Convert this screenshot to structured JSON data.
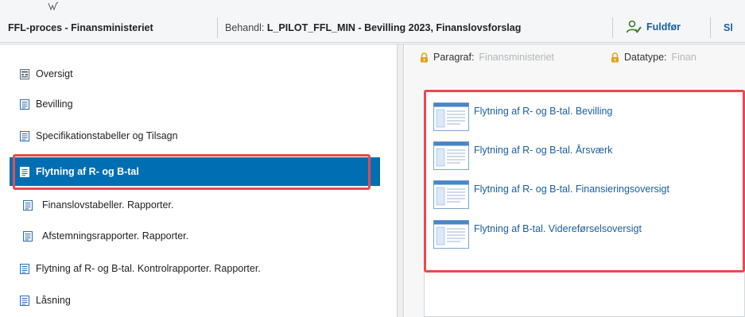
{
  "header": {
    "title": "FFL-proces - Finansministeriet",
    "behandl_label": "Behandl:",
    "behandl_value": "L_PILOT_FFL_MIN - Bevilling 2023, Finanslovsforslag",
    "fuldfor_label": "Fuldfør",
    "truncated_button": "Sl"
  },
  "sidebar": {
    "items": [
      {
        "label": "Oversigt",
        "icon": "overview-icon"
      },
      {
        "label": "Bevilling",
        "icon": "document-icon"
      },
      {
        "label": "Specifikationstabeller og Tilsagn",
        "icon": "document-icon"
      },
      {
        "label": "Flytning af R- og B-tal",
        "icon": "document-icon",
        "active": true
      },
      {
        "label": "Finanslovstabeller. Rapporter.",
        "icon": "document-icon"
      },
      {
        "label": "Afstemningsrapporter. Rapporter.",
        "icon": "document-icon"
      },
      {
        "label": "Flytning af R- og B-tal. Kontrolrapporter. Rapporter.",
        "icon": "document-icon"
      },
      {
        "label": "Låsning",
        "icon": "document-icon"
      }
    ]
  },
  "filters": {
    "paragraf_label": "Paragraf:",
    "paragraf_value": "Finansministeriet",
    "datatype_label": "Datatype:",
    "datatype_value": "Finan"
  },
  "tiles": [
    {
      "label": "Flytning af R- og B-tal. Bevilling"
    },
    {
      "label": "Flytning af R- og B-tal. Årsværk"
    },
    {
      "label": "Flytning af R- og B-tal. Finansieringsoversigt"
    },
    {
      "label": "Flytning af B-tal. Videreførselsoversigt"
    }
  ],
  "colors": {
    "active_nav": "#006eb2",
    "link": "#1a5e9e",
    "highlight": "#e84a4f",
    "lock": "#e2a21a"
  }
}
